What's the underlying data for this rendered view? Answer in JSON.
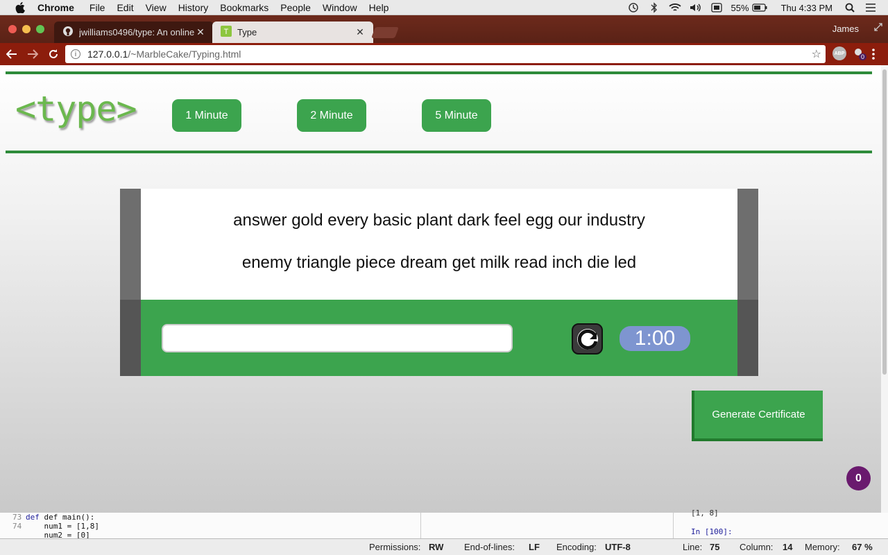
{
  "menubar": {
    "app": "Chrome",
    "items": [
      "File",
      "Edit",
      "View",
      "History",
      "Bookmarks",
      "People",
      "Window",
      "Help"
    ],
    "battery": "55%",
    "clock": "Thu 4:33 PM"
  },
  "browser": {
    "tabs": [
      {
        "label": "jwilliams0496/type: An online"
      },
      {
        "label": "Type"
      }
    ],
    "profile": "James",
    "url_host": "127.0.0.1",
    "url_path": "/~MarbleCake/Typing.html",
    "extension_badge": "0"
  },
  "page": {
    "logo": "<type>",
    "durations": [
      "1 Minute",
      "2 Minute",
      "5 Minute"
    ],
    "word_lines": [
      "answer gold every basic plant dark feel egg our industry",
      "enemy triangle piece dream get milk read inch die led"
    ],
    "input_value": "",
    "timer": "1:00",
    "certificate_label": "Generate Certificate",
    "notification_count": "0"
  },
  "editor": {
    "lines": [
      {
        "num": "73",
        "text": "def main():"
      },
      {
        "num": "74",
        "text": "    num1 = [1,8]"
      },
      {
        "num": "",
        "text": "    num2 = [0]"
      }
    ],
    "console_top": "[1, 8]",
    "console_prompt": "In [100]:"
  },
  "statusbar": {
    "permissions_label": "Permissions:",
    "permissions": "RW",
    "eol_label": "End-of-lines:",
    "eol": "LF",
    "encoding_label": "Encoding:",
    "encoding": "UTF-8",
    "line_label": "Line:",
    "line": "75",
    "column_label": "Column:",
    "column": "14",
    "memory_label": "Memory:",
    "memory": "67 %"
  },
  "colors": {
    "accent_green": "#3ca44e",
    "timer_blue": "#7e95d0",
    "chrome_frame": "#8c1d0c",
    "badge_purple": "#6a1a6e"
  }
}
